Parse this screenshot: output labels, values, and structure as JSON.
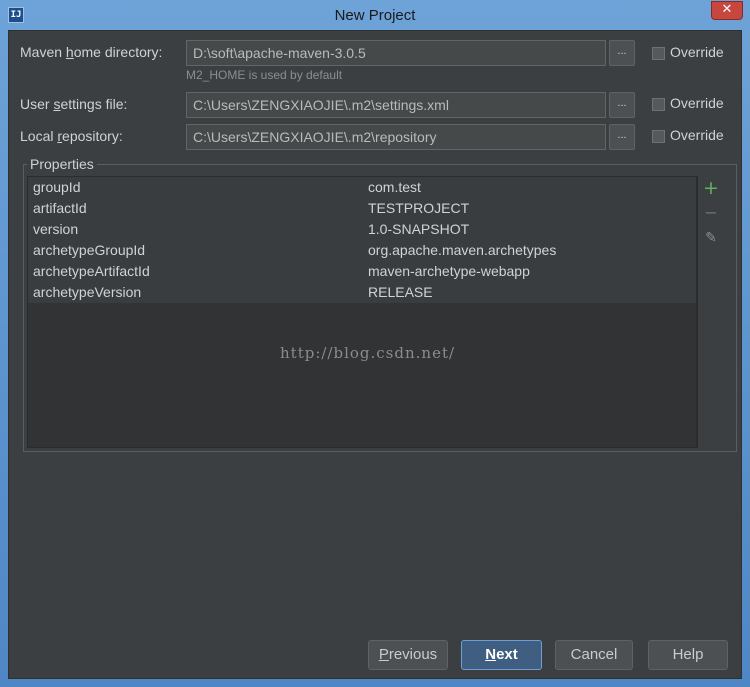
{
  "window": {
    "title": "New Project",
    "app_icon_text": "IJ",
    "close_label": "✕"
  },
  "maven": {
    "home_label_pre": "Maven ",
    "home_label_u": "h",
    "home_label_post": "ome directory:",
    "home_value": "D:\\soft\\apache-maven-3.0.5",
    "home_hint": "M2_HOME is used by default",
    "settings_label_pre": "User ",
    "settings_label_u": "s",
    "settings_label_post": "ettings file:",
    "settings_value": "C:\\Users\\ZENGXIAOJIE\\.m2\\settings.xml",
    "repo_label_pre": "Local ",
    "repo_label_u": "r",
    "repo_label_post": "epository:",
    "repo_value": "C:\\Users\\ZENGXIAOJIE\\.m2\\repository",
    "browse_label": "...",
    "override_label": "Override"
  },
  "properties": {
    "title": "Properties",
    "rows": [
      {
        "key": "groupId",
        "value": "com.test"
      },
      {
        "key": "artifactId",
        "value": "TESTPROJECT"
      },
      {
        "key": "version",
        "value": "1.0-SNAPSHOT"
      },
      {
        "key": "archetypeGroupId",
        "value": "org.apache.maven.archetypes"
      },
      {
        "key": "archetypeArtifactId",
        "value": "maven-archetype-webapp"
      },
      {
        "key": "archetypeVersion",
        "value": "RELEASE"
      }
    ],
    "add_icon": "+",
    "remove_icon": "−",
    "edit_icon": "✎"
  },
  "watermark": "http://blog.csdn.net/",
  "buttons": {
    "previous_u": "P",
    "previous_rest": "revious",
    "next_u": "N",
    "next_rest": "ext",
    "cancel": "Cancel",
    "help": "Help"
  },
  "colors": {
    "add": "#5fb05f",
    "icon_muted": "#8a8d8f"
  }
}
